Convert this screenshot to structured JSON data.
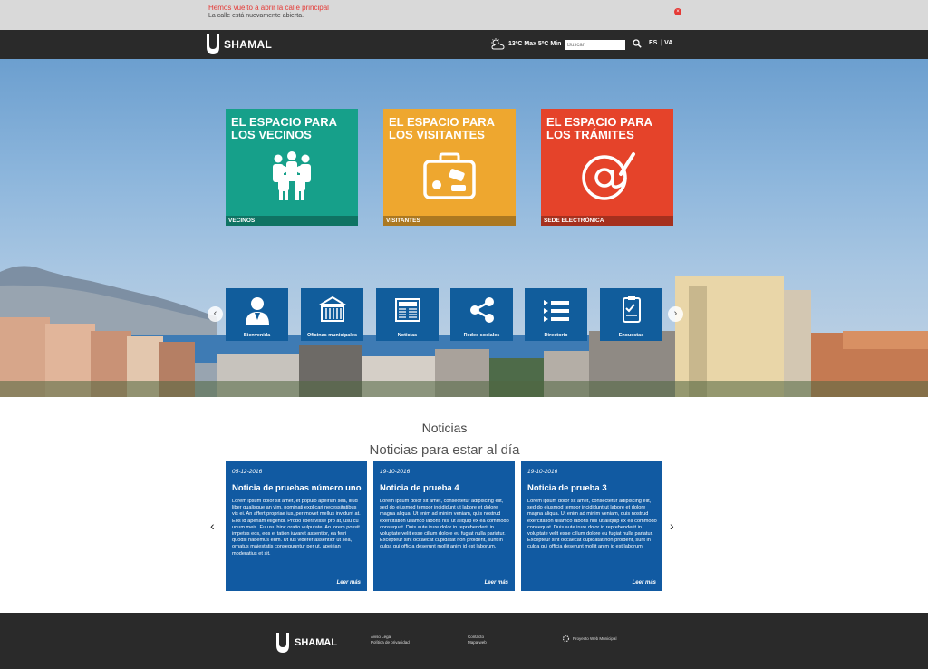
{
  "alert": {
    "title": "Hemos vuelto a abrir la calle principal",
    "text": "La calle está nuevamente abierta.",
    "close_icon": "close-icon"
  },
  "header": {
    "logo_text": "SHAMAL",
    "weather": "13ºC Max 5ºC Min",
    "weather_icon": "partly-cloudy-icon",
    "search_placeholder": "Buscar",
    "languages": [
      "ES",
      "VA"
    ]
  },
  "hero": {
    "big_tiles": [
      {
        "title": "EL ESPACIO PARA LOS VECINOS",
        "label": "VECINOS",
        "color": "#16a08a",
        "icon": "people-group-icon"
      },
      {
        "title": "EL ESPACIO PARA LOS VISITANTES",
        "label": "VISITANTES",
        "color": "#eea72f",
        "icon": "suitcase-icon"
      },
      {
        "title": "EL ESPACIO PARA LOS TRÁMITES",
        "label": "SEDE ELECTRÓNICA",
        "color": "#e5432a",
        "icon": "at-sign-icon"
      }
    ],
    "small_tiles": [
      {
        "label": "Bienvenida",
        "icon": "person-icon"
      },
      {
        "label": "Oficinas municipales",
        "icon": "building-icon"
      },
      {
        "label": "Noticias",
        "icon": "newspaper-icon"
      },
      {
        "label": "Redes sociales",
        "icon": "share-icon"
      },
      {
        "label": "Directorio",
        "icon": "list-icon"
      },
      {
        "label": "Encuestas",
        "icon": "survey-icon"
      }
    ]
  },
  "news": {
    "title": "Noticias",
    "subtitle": "Noticias para estar al día",
    "read_more": "Leer más",
    "cards": [
      {
        "date": "05-12-2016",
        "title": "Noticia de pruebas número uno",
        "body": "Lorem ipsum dolor sit amet, et populo apeirian sea, illud liber qualisque an vim, nominati explicari necessitatibus vis ei. An affert propriae ius, per movet mellus invidunt at. Eos id aperiam eligendi. Probo liberavisse pro at, usu cu unum meis. Eu usu hinc oratio vulputate. An lorem possit impetus eos, eos ei tation iuvaret assentior, ea ferri quodsi habemus eum. Ut ius viderer assentior ut sea, ornatus maiestatis consequuntur per ut, apeirian moderatius et sit."
      },
      {
        "date": "19-10-2016",
        "title": "Noticia de prueba 4",
        "body": "Lorem ipsum dolor sit amet, consectetur adipiscing elit, sed do eiusmod tempor incididunt ut labore et dolore magna aliqua. Ut enim ad minim veniam, quis nostrud exercitation ullamco laboris nisi ut aliquip ex ea commodo consequat. Duis aute irure dolor in reprehenderit in voluptate velit esse cillum dolore eu fugiat nulla pariatur. Excepteur sint occaecat cupidatat non proident, sunt in culpa qui officia deserunt mollit anim id est laborum."
      },
      {
        "date": "19-10-2016",
        "title": "Noticia de prueba 3",
        "body": "Lorem ipsum dolor sit amet, consectetur adipiscing elit, sed do eiusmod tempor incididunt ut labore et dolore magna aliqua. Ut enim ad minim veniam, quis nostrud exercitation ullamco laboris nisi ut aliquip ex ea commodo consequat. Duis aute irure dolor in reprehenderit in voluptate velit esse cillum dolore eu fugiat nulla pariatur. Excepteur sint occaecat cupidatat non proident, sunt in culpa qui officia deserunt mollit anim id est laborum."
      }
    ]
  },
  "footer": {
    "logo_text": "SHAMAL",
    "links_col1": [
      "Aviso Legal",
      "Política de privacidad"
    ],
    "links_col2": [
      "Contacto",
      "Mapa web"
    ],
    "project": "Proyecto Web Municipal"
  }
}
